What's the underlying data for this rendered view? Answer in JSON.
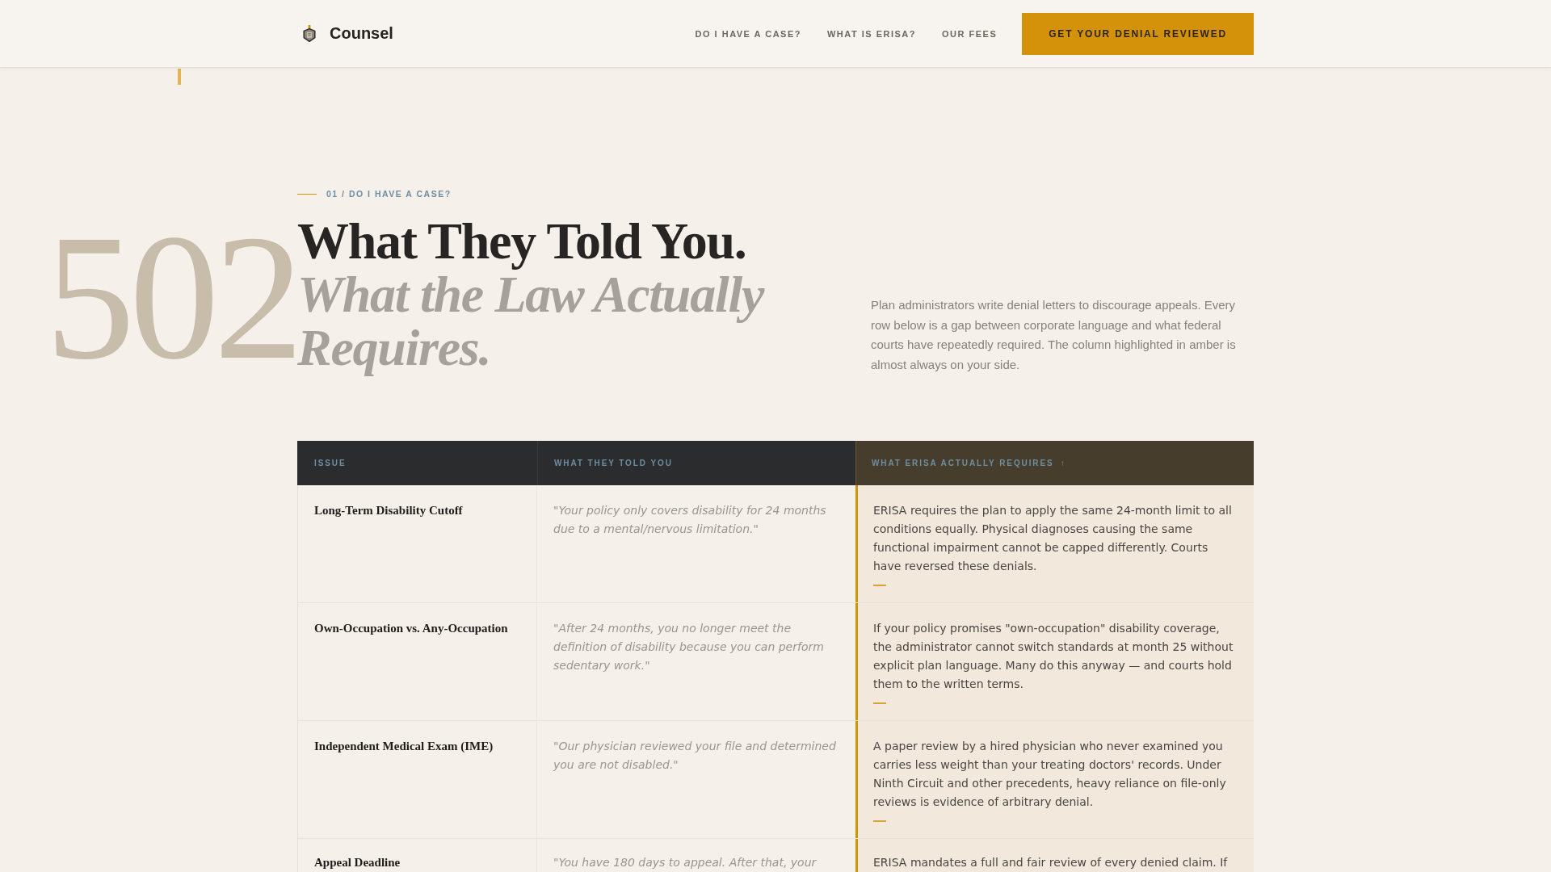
{
  "header": {
    "brand": "Counsel",
    "nav": [
      "DO I HAVE A CASE?",
      "WHAT IS ERISA?",
      "OUR FEES"
    ],
    "cta": "GET YOUR DENIAL REVIEWED"
  },
  "background_numeral": "502",
  "intro": {
    "eyebrow": "01 / DO I HAVE A CASE?",
    "title": "What They Told You.",
    "subtitle": "What the Law Actually Requires.",
    "description": "Plan administrators write denial letters to discourage appeals. Every row below is a gap between corporate language and what federal courts have repeatedly required. The column highlighted in amber is almost always on your side."
  },
  "table": {
    "columns": [
      {
        "label": "ISSUE",
        "kind": "issue",
        "highlighted": false
      },
      {
        "label": "WHAT THEY TOLD YOU",
        "kind": "quote",
        "highlighted": false
      },
      {
        "label": "WHAT ERISA ACTUALLY REQUIRES",
        "mark": "↑",
        "kind": "requirement",
        "highlighted": true
      }
    ],
    "rows": [
      {
        "cells": [
          "Long-Term Disability Cutoff",
          "\"Your policy only covers disability for 24 months due to a mental/nervous limitation.\"",
          "ERISA requires the plan to apply the same 24-month limit to all conditions equally. Physical diagnoses causing the same functional impairment cannot be capped differently. Courts have reversed these denials."
        ]
      },
      {
        "cells": [
          "Own-Occupation vs. Any-Occupation",
          "\"After 24 months, you no longer meet the definition of disability because you can perform sedentary work.\"",
          "If your policy promises \"own-occupation\" disability coverage, the administrator cannot switch standards at month 25 without explicit plan language. Many do this anyway — and courts hold them to the written terms."
        ]
      },
      {
        "cells": [
          "Independent Medical Exam (IME)",
          "\"Our physician reviewed your file and determined you are not disabled.\"",
          "A paper review by a hired physician who never examined you carries less weight than your treating doctors' records. Under Ninth Circuit and other precedents, heavy reliance on file-only reviews is evidence of arbitrary denial."
        ]
      },
      {
        "cells": [
          "Appeal Deadline",
          "\"You have 180 days to appeal. After that, your",
          "ERISA mandates a full and fair review of every denied claim. If"
        ]
      }
    ]
  }
}
